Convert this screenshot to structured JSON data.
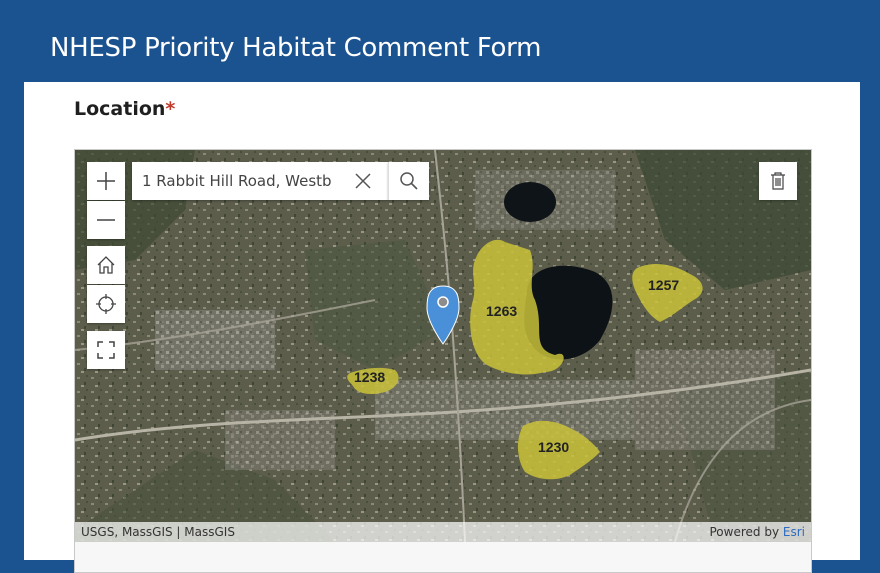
{
  "header": {
    "title": "NHESP Priority Habitat Comment Form"
  },
  "form": {
    "location_label": "Location",
    "required_marker": "*"
  },
  "map": {
    "search": {
      "value": "1 Rabbit Hill Road, Westb"
    },
    "controls": {
      "zoom_in_icon": "plus-icon",
      "zoom_out_icon": "minus-icon",
      "home_icon": "home-icon",
      "locate_icon": "crosshair-icon",
      "fullscreen_icon": "expand-icon",
      "delete_icon": "trash-icon",
      "search_icon": "magnifier-icon",
      "clear_icon": "close-icon"
    },
    "habitat_labels": [
      "1263",
      "1257",
      "1238",
      "1230"
    ],
    "attribution": {
      "sources": "USGS, MassGIS | MassGIS",
      "powered_by": "Powered by",
      "esri": "Esri"
    },
    "colors": {
      "habitat_fill": "#c9c23a",
      "marker": "#4a90d9",
      "header": "#1b5290"
    }
  }
}
